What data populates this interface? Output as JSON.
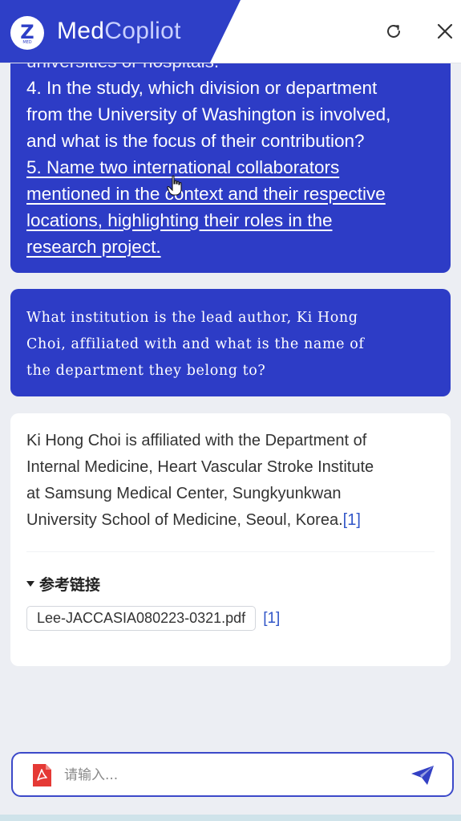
{
  "header": {
    "logo_letter": "Z",
    "logo_sub": "MED",
    "brand_part1": "Med",
    "brand_part2": "Copliot"
  },
  "messages": {
    "user1": {
      "partial_line": "universities or hospitals.",
      "lines": [
        "4. In the study, which division or department",
        "from the University of Washington is involved,",
        "and what is the focus of their contribution?",
        "5. Name two international collaborators",
        "mentioned in the context and their respective",
        "locations, highlighting their roles in the",
        "research project."
      ]
    },
    "user2": {
      "lines": [
        "What institution is the lead author, Ki Hong",
        "Choi, affiliated with and what is the name of",
        "the department they belong to?"
      ]
    },
    "bot": {
      "lines": [
        "Ki Hong Choi is affiliated with the Department of",
        "Internal Medicine, Heart Vascular Stroke Institute",
        "at Samsung Medical Center, Sungkyunkwan",
        "University School of Medicine, Seoul, Korea."
      ],
      "citation": "[1]",
      "refs_title": "参考链接",
      "refs": [
        {
          "file": "Lee-JACCASIA080223-0321.pdf",
          "num": "[1]"
        }
      ]
    }
  },
  "input": {
    "placeholder": "请输入..."
  },
  "icons": {
    "refresh": "refresh-icon",
    "close": "close-icon",
    "pdf": "pdf-icon",
    "send": "send-icon",
    "cursor": "hand-cursor-icon"
  },
  "colors": {
    "primary": "#2d3cc6",
    "background": "#eceef3",
    "citation": "#3156c8",
    "pdf_red": "#e53935"
  }
}
